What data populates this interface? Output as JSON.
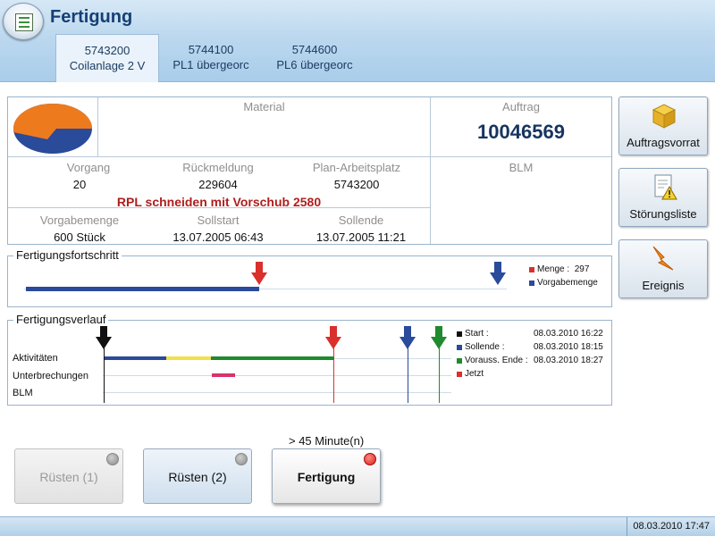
{
  "header": {
    "title": "Fertigung",
    "tabs": [
      {
        "line1": "5743200",
        "line2": "Coilanlage 2 V"
      },
      {
        "line1": "5744100",
        "line2": "PL1 übergeorc"
      },
      {
        "line1": "5744600",
        "line2": "PL6 übergeorc"
      }
    ]
  },
  "info": {
    "material_label": "Material",
    "auftrag_label": "Auftrag",
    "auftrag_value": "10046569",
    "vorgang_label": "Vorgang",
    "vorgang_value": "20",
    "rueckmeldung_label": "Rückmeldung",
    "rueckmeldung_value": "229604",
    "plan_label": "Plan-Arbeitsplatz",
    "plan_value": "5743200",
    "blm_label": "BLM",
    "operation_text": "RPL schneiden mit Vorschub 2580",
    "vorgabemenge_label": "Vorgabemenge",
    "vorgabemenge_value": "600 Stück",
    "sollstart_label": "Sollstart",
    "sollstart_value": "13.07.2005 06:43",
    "sollende_label": "Sollende",
    "sollende_value": "13.07.2005 11:21"
  },
  "side_buttons": {
    "auftragsvorrat": "Auftragsvorrat",
    "stoerungsliste": "Störungsliste",
    "ereignis": "Ereignis"
  },
  "progress": {
    "title": "Fertigungsfortschritt",
    "menge_label": "Menge :",
    "menge_value": "297",
    "vorgabe_label": "Vorgabemenge",
    "menge_total": 600,
    "menge_current": 297
  },
  "timeline": {
    "title": "Fertigungsverlauf",
    "rows": [
      "Aktivitäten",
      "Unterbrechungen",
      "BLM"
    ],
    "legend": [
      {
        "label": "Start :",
        "time": "08.03.2010 16:22",
        "color": "#111111"
      },
      {
        "label": "Sollende :",
        "time": "08.03.2010 18:15",
        "color": "#2a4a9a"
      },
      {
        "label": "Vorauss. Ende :",
        "time": "08.03.2010 18:27",
        "color": "#1f8a2e"
      },
      {
        "label": "Jetzt",
        "time": "",
        "color": "#d9302c"
      }
    ]
  },
  "bottom": {
    "info_text": "> 45 Minute(n)",
    "btn1": "Rüsten (1)",
    "btn2": "Rüsten (2)",
    "btn3": "Fertigung"
  },
  "status": {
    "datetime": "08.03.2010 17:47"
  },
  "colors": {
    "accent": "#153f75",
    "red": "#d9302c",
    "blue": "#2a4a9a",
    "green": "#1f8a2e",
    "yellow": "#f2e04a",
    "pink": "#d8336a"
  }
}
